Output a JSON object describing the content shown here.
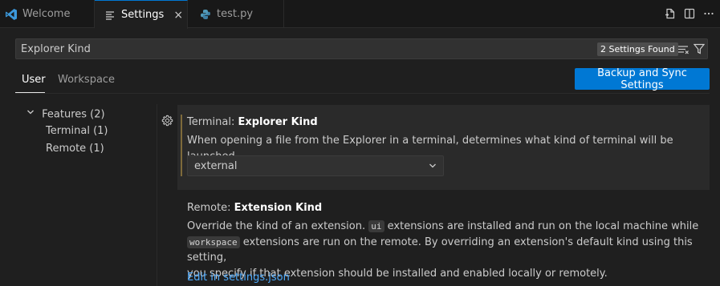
{
  "tabs": [
    {
      "label": "Welcome",
      "icon": "vscode-logo-icon"
    },
    {
      "label": "Settings",
      "icon": "settings-file-icon",
      "active": true
    },
    {
      "label": "test.py",
      "icon": "python-icon"
    }
  ],
  "close_glyph": "×",
  "search": {
    "value": "Explorer Kind",
    "result_count": "2 Settings Found"
  },
  "scopes": {
    "user": "User",
    "workspace": "Workspace"
  },
  "sync_button": "Backup and Sync Settings",
  "toc": [
    {
      "label": "Features (2)",
      "expanded": true
    },
    {
      "label": "Terminal (1)"
    },
    {
      "label": "Remote (1)"
    }
  ],
  "settings": [
    {
      "category": "Terminal: ",
      "name": "Explorer Kind",
      "description": "When opening a file from the Explorer in a terminal, determines what kind of terminal will be launched",
      "value": "external"
    },
    {
      "category": "Remote: ",
      "name": "Extension Kind",
      "desc": {
        "p1": "Override the kind of an extension. ",
        "code1": "ui",
        "p2": " extensions are installed and run on the local machine while",
        "code2": "workspace",
        "p3": " extensions are run on the remote. By overriding an extension's default kind using this setting,",
        "p4": "you specify if that extension should be installed and enabled locally or remotely."
      },
      "link": "Edit in settings.json"
    }
  ],
  "colors": {
    "accent": "#0078d4",
    "link": "#4daafc",
    "modified_indicator": "#7e6a3a"
  }
}
